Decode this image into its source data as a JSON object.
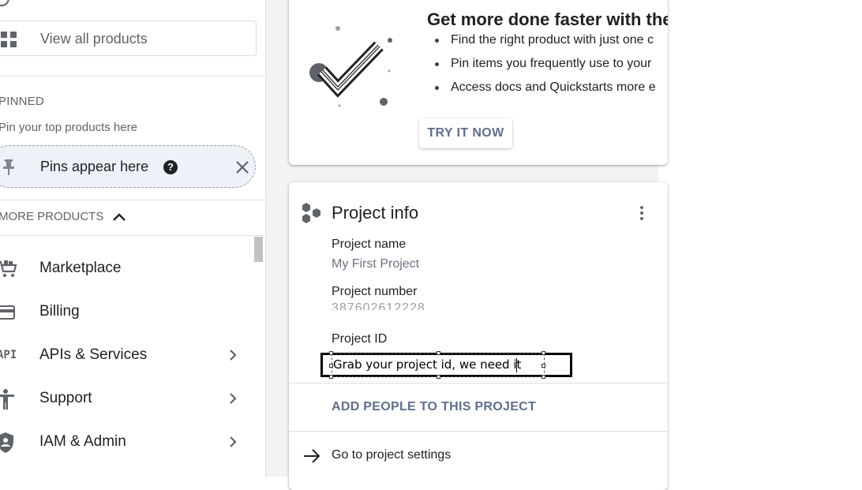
{
  "sidebar": {
    "view_all": "View all products",
    "pinned_title": "PINNED",
    "pinned_hint": "Pin your top products here",
    "pins_chip": "Pins appear here",
    "help_glyph": "?",
    "more_products": "MORE PRODUCTS",
    "items": [
      {
        "label": "Marketplace",
        "icon": "cart-icon",
        "chevron": false
      },
      {
        "label": "Billing",
        "icon": "credit-card-icon",
        "chevron": false
      },
      {
        "label": "APIs & Services",
        "icon": "api-icon",
        "icon_text": "API",
        "chevron": true
      },
      {
        "label": "Support",
        "icon": "support-icon",
        "chevron": true
      },
      {
        "label": "IAM & Admin",
        "icon": "shield-icon",
        "chevron": true
      }
    ]
  },
  "promo": {
    "title": "Get more done faster with the",
    "bullets": [
      "Find the right product with just one c",
      "Pin items you frequently use to your",
      "Access docs and Quickstarts more e"
    ],
    "button": "TRY IT NOW"
  },
  "project_info": {
    "title": "Project info",
    "name_label": "Project name",
    "name_value": "My First Project",
    "number_label": "Project number",
    "number_value": "387602612228",
    "id_label": "Project ID",
    "annotation": "Grab your project id, we need it",
    "add_people": "ADD PEOPLE TO THIS PROJECT",
    "go_settings": "Go to project settings"
  },
  "colors": {
    "accent_text": "#5f6e8a",
    "chip_bg": "#eef2f8",
    "gutter_bg": "#f1f3f4"
  }
}
